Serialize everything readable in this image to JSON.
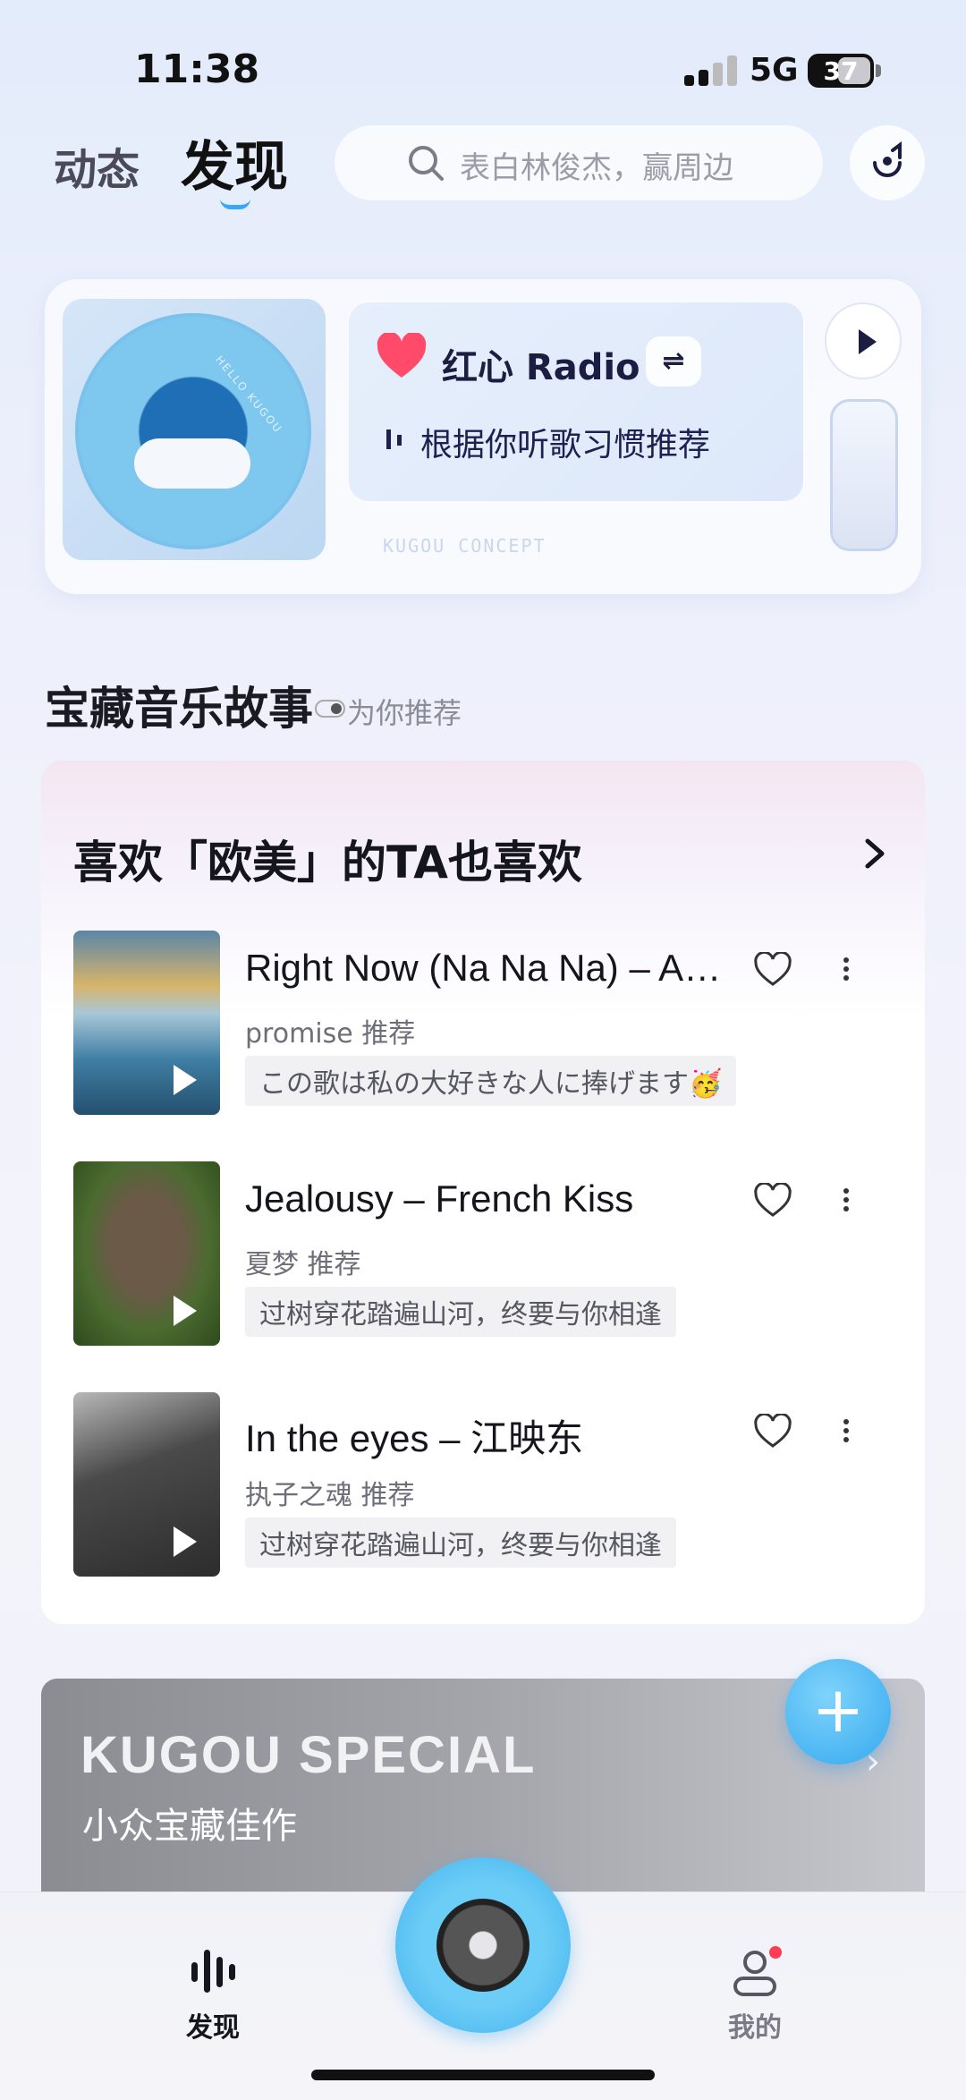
{
  "status_bar": {
    "time": "11:38",
    "network": "5G",
    "battery": "37"
  },
  "header": {
    "tab_following": "动态",
    "tab_discover": "发现",
    "search_placeholder": "表白林俊杰，赢周边"
  },
  "radio": {
    "title": "红心 Radio",
    "subtitle": "根据你听歌习惯推荐",
    "concept_label": "KUGOU CONCEPT",
    "vinyl_label": "HELLO KUGOU"
  },
  "section": {
    "title": "宝藏音乐故事",
    "subtitle": "为你推荐"
  },
  "story": {
    "heading": "喜欢「欧美」的TA也喜欢",
    "songs": [
      {
        "title": "Right Now (Na Na Na) – Akon",
        "recommender": "promise 推荐",
        "comment": "この歌は私の大好きな人に捧げます🥳"
      },
      {
        "title": "Jealousy – French Kiss",
        "recommender": "夏梦 推荐",
        "comment": "过树穿花踏遍山河，终要与你相逢"
      },
      {
        "title": "In the eyes – 江映东",
        "recommender": "执子之魂 推荐",
        "comment": "过树穿花踏遍山河，终要与你相逢"
      }
    ]
  },
  "special": {
    "title": "KUGOU SPECIAL",
    "subtitle": "小众宝藏佳作"
  },
  "bottom_nav": {
    "discover": "发现",
    "mine": "我的"
  },
  "colors": {
    "accent": "#39a7f5",
    "heart": "#ff4a6a",
    "badge_dot": "#ff3b55"
  }
}
